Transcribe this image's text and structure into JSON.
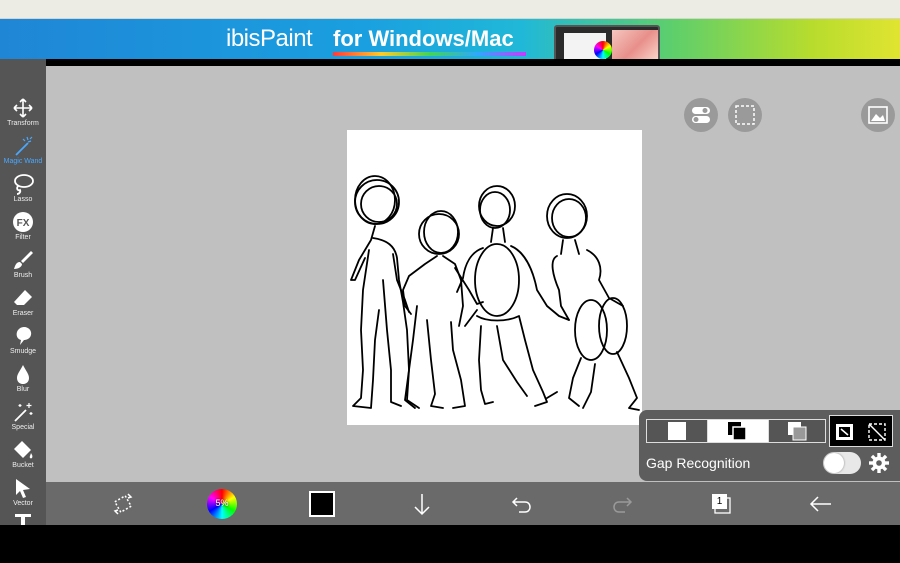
{
  "banner": {
    "logo_text": "ibisPaint",
    "tagline": "for Windows/Mac"
  },
  "tools": [
    {
      "id": "transform",
      "label": "Transform",
      "icon": "move-arrows-icon",
      "active": false
    },
    {
      "id": "magic-wand",
      "label": "Magic Wand",
      "icon": "magic-wand-icon",
      "active": true
    },
    {
      "id": "lasso",
      "label": "Lasso",
      "icon": "lasso-icon",
      "active": false
    },
    {
      "id": "filter",
      "label": "Filter",
      "icon": "fx-icon",
      "active": false
    },
    {
      "id": "brush",
      "label": "Brush",
      "icon": "brush-icon",
      "active": false
    },
    {
      "id": "eraser",
      "label": "Eraser",
      "icon": "eraser-icon",
      "active": false
    },
    {
      "id": "smudge",
      "label": "Smudge",
      "icon": "smudge-icon",
      "active": false
    },
    {
      "id": "blur",
      "label": "Blur",
      "icon": "blur-drop-icon",
      "active": false
    },
    {
      "id": "special",
      "label": "Special",
      "icon": "sparkle-wand-icon",
      "active": false
    },
    {
      "id": "bucket",
      "label": "Bucket",
      "icon": "bucket-icon",
      "active": false
    },
    {
      "id": "vector",
      "label": "Vector",
      "icon": "cursor-arrow-icon",
      "active": false
    },
    {
      "id": "text",
      "label": "",
      "icon": "text-icon",
      "active": false
    }
  ],
  "bottombar": {
    "brush_opacity_label": "5%",
    "current_color": "#000000",
    "layer_count": "1"
  },
  "magic_wand_panel": {
    "gap_recognition_label": "Gap Recognition",
    "gap_recognition_on": false,
    "selection_mode_selected": "add"
  },
  "colors": {
    "toolbar_bg": "#555555",
    "canvas_bg": "#c0c0c0",
    "active_tool": "#4aa8ff"
  }
}
